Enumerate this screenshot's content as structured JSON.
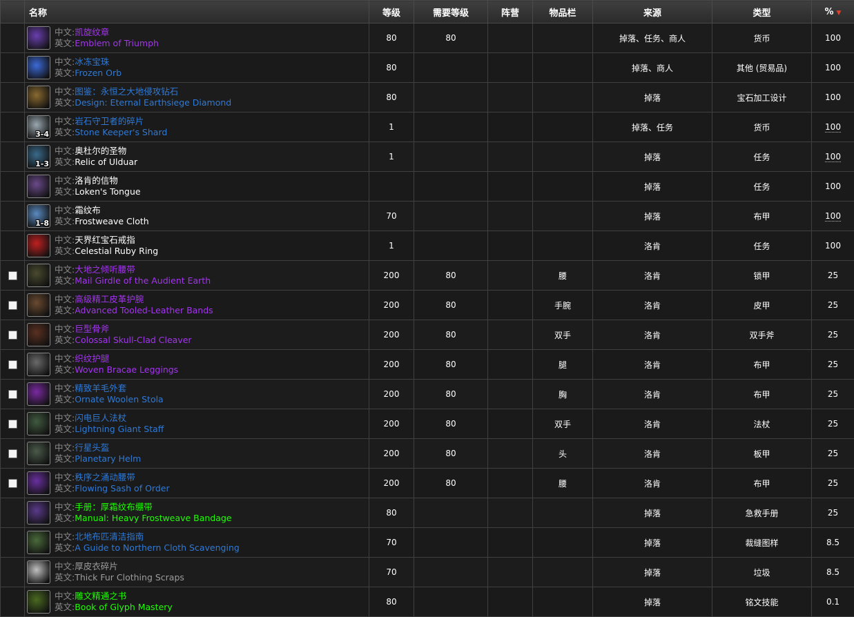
{
  "headers": {
    "name": "名称",
    "level": "等级",
    "req_level": "需要等级",
    "faction": "阵营",
    "slot": "物品栏",
    "source": "来源",
    "type": "类型",
    "percent": "%"
  },
  "labels": {
    "cn": "中文:",
    "en": "英文:"
  },
  "rows": [
    {
      "cn": "凯旋纹章",
      "en": "Emblem of Triumph",
      "level": "80",
      "req": "80",
      "faction": "",
      "slot": "",
      "source": "掉落、任务、商人",
      "type": "货币",
      "pct": "100",
      "color": "purple",
      "checkbox": false,
      "stack": "",
      "pct_link": false
    },
    {
      "cn": "冰冻宝珠",
      "en": "Frozen Orb",
      "level": "80",
      "req": "",
      "faction": "",
      "slot": "",
      "source": "掉落、商人",
      "type": "其他 (贸易品)",
      "pct": "100",
      "color": "blue",
      "checkbox": false,
      "stack": "",
      "pct_link": false
    },
    {
      "cn": "图鉴：永恒之大地侵攻钻石",
      "en": "Design: Eternal Earthsiege Diamond",
      "level": "80",
      "req": "",
      "faction": "",
      "slot": "",
      "source": "掉落",
      "type": "宝石加工设计",
      "pct": "100",
      "color": "blue",
      "checkbox": false,
      "stack": "",
      "pct_link": false
    },
    {
      "cn": "岩石守卫者的碎片",
      "en": "Stone Keeper's Shard",
      "level": "1",
      "req": "",
      "faction": "",
      "slot": "",
      "source": "掉落、任务",
      "type": "货币",
      "pct": "100",
      "color": "blue",
      "checkbox": false,
      "stack": "3-4",
      "pct_link": true
    },
    {
      "cn": "奥杜尔的圣物",
      "en": "Relic of Ulduar",
      "level": "1",
      "req": "",
      "faction": "",
      "slot": "",
      "source": "掉落",
      "type": "任务",
      "pct": "100",
      "color": "white",
      "checkbox": false,
      "stack": "1-3",
      "pct_link": true
    },
    {
      "cn": "洛肯的信物",
      "en": "Loken's Tongue",
      "level": "",
      "req": "",
      "faction": "",
      "slot": "",
      "source": "掉落",
      "type": "任务",
      "pct": "100",
      "color": "white",
      "checkbox": false,
      "stack": "",
      "pct_link": false
    },
    {
      "cn": "霜纹布",
      "en": "Frostweave Cloth",
      "level": "70",
      "req": "",
      "faction": "",
      "slot": "",
      "source": "掉落",
      "type": "布甲",
      "pct": "100",
      "color": "white",
      "checkbox": false,
      "stack": "1-8",
      "pct_link": true
    },
    {
      "cn": "天界红宝石戒指",
      "en": "Celestial Ruby Ring",
      "level": "1",
      "req": "",
      "faction": "",
      "slot": "",
      "source": "洛肯",
      "type": "任务",
      "pct": "100",
      "color": "white",
      "checkbox": false,
      "stack": "",
      "pct_link": false
    },
    {
      "cn": "大地之倾听腰带",
      "en": "Mail Girdle of the Audient Earth",
      "level": "200",
      "req": "80",
      "faction": "",
      "slot": "腰",
      "source": "洛肯",
      "type": "锁甲",
      "pct": "25",
      "color": "purple",
      "checkbox": true,
      "stack": "",
      "pct_link": false
    },
    {
      "cn": "高级精工皮革护腕",
      "en": "Advanced Tooled-Leather Bands",
      "level": "200",
      "req": "80",
      "faction": "",
      "slot": "手腕",
      "source": "洛肯",
      "type": "皮甲",
      "pct": "25",
      "color": "purple",
      "checkbox": true,
      "stack": "",
      "pct_link": false
    },
    {
      "cn": "巨型骨斧",
      "en": "Colossal Skull-Clad Cleaver",
      "level": "200",
      "req": "80",
      "faction": "",
      "slot": "双手",
      "source": "洛肯",
      "type": "双手斧",
      "pct": "25",
      "color": "purple",
      "checkbox": true,
      "stack": "",
      "pct_link": false
    },
    {
      "cn": "织纹护腿",
      "en": "Woven Bracae Leggings",
      "level": "200",
      "req": "80",
      "faction": "",
      "slot": "腿",
      "source": "洛肯",
      "type": "布甲",
      "pct": "25",
      "color": "purple",
      "checkbox": true,
      "stack": "",
      "pct_link": false
    },
    {
      "cn": "精致羊毛外套",
      "en": "Ornate Woolen Stola",
      "level": "200",
      "req": "80",
      "faction": "",
      "slot": "胸",
      "source": "洛肯",
      "type": "布甲",
      "pct": "25",
      "color": "blue",
      "checkbox": true,
      "stack": "",
      "pct_link": false
    },
    {
      "cn": "闪电巨人法杖",
      "en": "Lightning Giant Staff",
      "level": "200",
      "req": "80",
      "faction": "",
      "slot": "双手",
      "source": "洛肯",
      "type": "法杖",
      "pct": "25",
      "color": "blue",
      "checkbox": true,
      "stack": "",
      "pct_link": false
    },
    {
      "cn": "行星头盔",
      "en": "Planetary Helm",
      "level": "200",
      "req": "80",
      "faction": "",
      "slot": "头",
      "source": "洛肯",
      "type": "板甲",
      "pct": "25",
      "color": "blue",
      "checkbox": true,
      "stack": "",
      "pct_link": false
    },
    {
      "cn": "秩序之涌动腰带",
      "en": "Flowing Sash of Order",
      "level": "200",
      "req": "80",
      "faction": "",
      "slot": "腰",
      "source": "洛肯",
      "type": "布甲",
      "pct": "25",
      "color": "blue",
      "checkbox": true,
      "stack": "",
      "pct_link": false
    },
    {
      "cn": "手册：厚霜纹布绷带",
      "en": "Manual: Heavy Frostweave Bandage",
      "level": "80",
      "req": "",
      "faction": "",
      "slot": "",
      "source": "掉落",
      "type": "急救手册",
      "pct": "25",
      "color": "green",
      "checkbox": false,
      "stack": "",
      "pct_link": false
    },
    {
      "cn": "北地布匹清洁指南",
      "en": "A Guide to Northern Cloth Scavenging",
      "level": "70",
      "req": "",
      "faction": "",
      "slot": "",
      "source": "掉落",
      "type": "裁缝图样",
      "pct": "8.5",
      "color": "blue",
      "checkbox": false,
      "stack": "",
      "pct_link": false
    },
    {
      "cn": "厚皮衣碎片",
      "en": "Thick Fur Clothing Scraps",
      "level": "70",
      "req": "",
      "faction": "",
      "slot": "",
      "source": "掉落",
      "type": "垃圾",
      "pct": "8.5",
      "color": "grey",
      "checkbox": false,
      "stack": "",
      "pct_link": false
    },
    {
      "cn": "雕文精通之书",
      "en": "Book of Glyph Mastery",
      "level": "80",
      "req": "",
      "faction": "",
      "slot": "",
      "source": "掉落",
      "type": "铭文技能",
      "pct": "0.1",
      "color": "green",
      "checkbox": false,
      "stack": "",
      "pct_link": false
    }
  ],
  "icons": [
    "emblem-icon",
    "orb-icon",
    "design-icon",
    "shard-icon",
    "relic-icon",
    "tongue-icon",
    "cloth-icon",
    "ring-icon",
    "girdle-icon",
    "bracers-icon",
    "axe-icon",
    "leggings-icon",
    "stola-icon",
    "staff-icon",
    "helm-icon",
    "sash-icon",
    "manual-icon",
    "guide-icon",
    "scraps-icon",
    "book-icon"
  ],
  "icon_colors": [
    "#6a3fb0",
    "#3c6ad8",
    "#8a6a30",
    "#9aa8b0",
    "#3a6a8a",
    "#6a4a8a",
    "#5a8ac0",
    "#c02020",
    "#4a4a30",
    "#6a4a30",
    "#5a3020",
    "#6a6a6a",
    "#7a2aa0",
    "#405a40",
    "#4a5a4a",
    "#6a30a0",
    "#5a3a8a",
    "#4a6a3a",
    "#c0c0c0",
    "#4a6a20"
  ]
}
